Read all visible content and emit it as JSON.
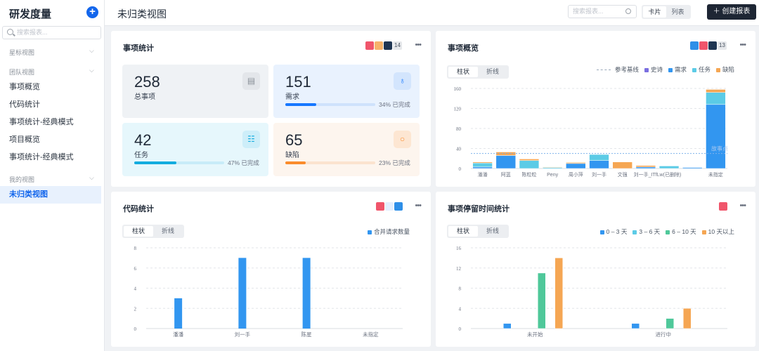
{
  "sidebar": {
    "title": "研发度量",
    "search_placeholder": "搜索报表...",
    "groups": [
      {
        "label": "星标视图"
      },
      {
        "label": "团队视图"
      },
      {
        "label": "我的视图"
      }
    ],
    "team_items": [
      "事项概览",
      "代码统计",
      "事项统计-经典模式",
      "项目概览",
      "事项统计-经典模式"
    ],
    "my_items": [
      "未归类视图"
    ],
    "active": "未归类视图"
  },
  "header": {
    "title": "未归类视图",
    "search_placeholder": "搜索报表...",
    "view_modes": [
      "卡片",
      "列表"
    ],
    "active_view": "卡片",
    "create_label": "创建报表"
  },
  "cards": {
    "stats": {
      "title": "事项统计",
      "app_count": "14",
      "items": [
        {
          "value": "258",
          "label": "总事项",
          "icon": "document-icon",
          "bg": "#eff2f5",
          "icon_bg": "#e3e6ea",
          "color": "#8a9099"
        },
        {
          "value": "151",
          "label": "需求",
          "icon": "lightbulb-icon",
          "progress": 34,
          "progress_text": "34% 已完成",
          "bg": "#e9f2fe",
          "icon_bg": "#d3e5fd",
          "color": "#1677ff",
          "track": "#cfe2fc"
        },
        {
          "value": "42",
          "label": "任务",
          "icon": "list-icon",
          "progress": 47,
          "progress_text": "47% 已完成",
          "bg": "#e6f7fc",
          "icon_bg": "#cdeef9",
          "color": "#13acdf",
          "track": "#c8ecf8"
        },
        {
          "value": "65",
          "label": "缺陷",
          "icon": "circle-icon",
          "progress": 23,
          "progress_text": "23% 已完成",
          "bg": "#fdf5ee",
          "icon_bg": "#fde6d2",
          "color": "#fa8c2c",
          "track": "#fbe3cf"
        }
      ]
    },
    "overview": {
      "title": "事项概览",
      "app_count": "13",
      "tabs": [
        "柱状",
        "折线"
      ],
      "active_tab": "柱状"
    },
    "code": {
      "title": "代码统计",
      "tabs": [
        "柱状",
        "折线"
      ],
      "active_tab": "柱状"
    },
    "dwell": {
      "title": "事项停留时间统计",
      "tabs": [
        "柱状",
        "折线"
      ],
      "active_tab": "柱状"
    }
  },
  "chart_data": [
    {
      "type": "bar",
      "stacked": true,
      "categories": [
        "潘潘",
        "阿蓝",
        "陈粒粒",
        "Peny",
        "周小萍",
        "刘一手",
        "文强",
        "刘一手_ITfLw(已删除)",
        "",
        "",
        "未指定"
      ],
      "series": [
        {
          "name": "史诗",
          "color": "#7b6fe0",
          "values": [
            0,
            0,
            0,
            0,
            0,
            0,
            0,
            0,
            0,
            0,
            0
          ]
        },
        {
          "name": "需求",
          "color": "#3296f0",
          "values": [
            3,
            26,
            0,
            0,
            10,
            16,
            0,
            3,
            0,
            2,
            128
          ]
        },
        {
          "name": "任务",
          "color": "#5ccbe6",
          "values": [
            8,
            0,
            16,
            2,
            0,
            12,
            0,
            0,
            5,
            0,
            24
          ]
        },
        {
          "name": "缺陷",
          "color": "#f5a653",
          "values": [
            2,
            7,
            3,
            1,
            2,
            0,
            13,
            3,
            0,
            0,
            6
          ]
        }
      ],
      "reference_line": {
        "legend": "参考基线",
        "label": "故事点",
        "value": 30
      },
      "ylim": [
        0,
        160
      ],
      "yticks": [
        0,
        40,
        80,
        120,
        160
      ],
      "grid": true,
      "legend": "top-right"
    },
    {
      "type": "bar",
      "categories": [
        "潘潘",
        "刘一手",
        "陈星",
        "未指定"
      ],
      "series": [
        {
          "name": "合并请求数量",
          "color": "#3296f0",
          "values": [
            3,
            7,
            7,
            0
          ]
        }
      ],
      "ylim": [
        0,
        8
      ],
      "yticks": [
        0,
        2,
        4,
        6,
        8
      ],
      "grid": true,
      "legend": "top-right"
    },
    {
      "type": "bar",
      "categories": [
        "未开始",
        "进行中"
      ],
      "series": [
        {
          "name": "0 – 3 天",
          "color": "#3296f0",
          "values": [
            1,
            1
          ]
        },
        {
          "name": "3 – 6 天",
          "color": "#5ccbe6",
          "values": [
            0,
            0
          ]
        },
        {
          "name": "6 – 10 天",
          "color": "#4fc89a",
          "values": [
            11,
            2
          ]
        },
        {
          "name": "10 天以上",
          "color": "#f5a653",
          "values": [
            14,
            4
          ]
        }
      ],
      "ylim": [
        0,
        16
      ],
      "yticks": [
        0,
        4,
        8,
        12,
        16
      ],
      "grid": true,
      "legend": "top-right"
    }
  ]
}
